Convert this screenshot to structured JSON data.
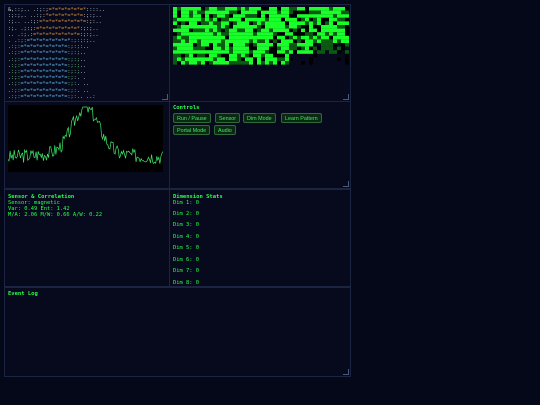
{
  "ascii_art": [
    "&,::;.. .:;:;=*=*=*=*=*=*::::..",
    ":;:;,. ..:;:*=*=*=*=*=*=:;:;..",
    ":;.. ..:;:=*=*=*=*=*=*=*=:;:..",
    ":;. .;:;:=*=*=*=*=*=*=*:;:;..",
    ".. .:;.:=*=*=*=*=*=*=*=:;:;..",
    ". .:;:=*=*=*=*=*=*=*:;:;:;..",
    ".:;:=*=*=*=*=*=*=*=:;:;:..",
    ".:;:=*=*=*=*=*=*=*=:;:;..",
    ".:;:=*=*=*=*=*=*=*=:;:;..",
    ".:;:=*=*=*=*=*=*=*=:;:;..",
    ".:;:=*=*=*=*=*=*=*=:;:;..",
    ".:;:=*=*=*=*=*=*=*=:;:. .",
    ".:;:=*=*=*=*=*=*=*=:;:. ..",
    ".:;:=*=*=*=*=*=*=*=:;:. ..",
    ".:;:=*=*=*=*=*=*=*=:;:.. ..:"
  ],
  "controls": {
    "title": "Controls",
    "buttons": [
      "Run / Pause",
      "Sensor",
      "Dim Mode",
      "Learn Pattern",
      "Portal Mode",
      "Audio"
    ]
  },
  "sensor": {
    "title": "Sensor & Correlation",
    "lines": [
      "Sensor: magnetic",
      "Var: 0.49 Ent: 1.42",
      "M/A: 2.06 M/W: 0.66 A/W: 0.22"
    ]
  },
  "dimensions": {
    "title": "Dimension Stats",
    "items": [
      "Dim 1: 0",
      "Dim 2: 0",
      "Dim 3: 0",
      "Dim 4: 0",
      "Dim 5: 0",
      "Dim 6: 0",
      "Dim 7: 0",
      "Dim 8: 0"
    ]
  },
  "event_log": {
    "title": "Event Log"
  },
  "colors": {
    "background": "#050818",
    "accent_green": "#2bff4a",
    "pixel_dark": "#0b5a12",
    "wave_line": "#3ee86a"
  }
}
